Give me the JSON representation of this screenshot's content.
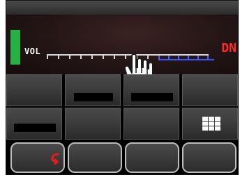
{
  "display": {
    "vol_label": "VOL",
    "mode_label": "DN",
    "volume_level": 0.72
  },
  "icons": {
    "hand": "hand-pointer-icon",
    "grid": "grid-menu-icon",
    "back": "back-arrow-icon"
  },
  "colors": {
    "signal_green": "#27b142",
    "accent_red": "#e71b1b",
    "accent_blue": "#3b54ff"
  }
}
